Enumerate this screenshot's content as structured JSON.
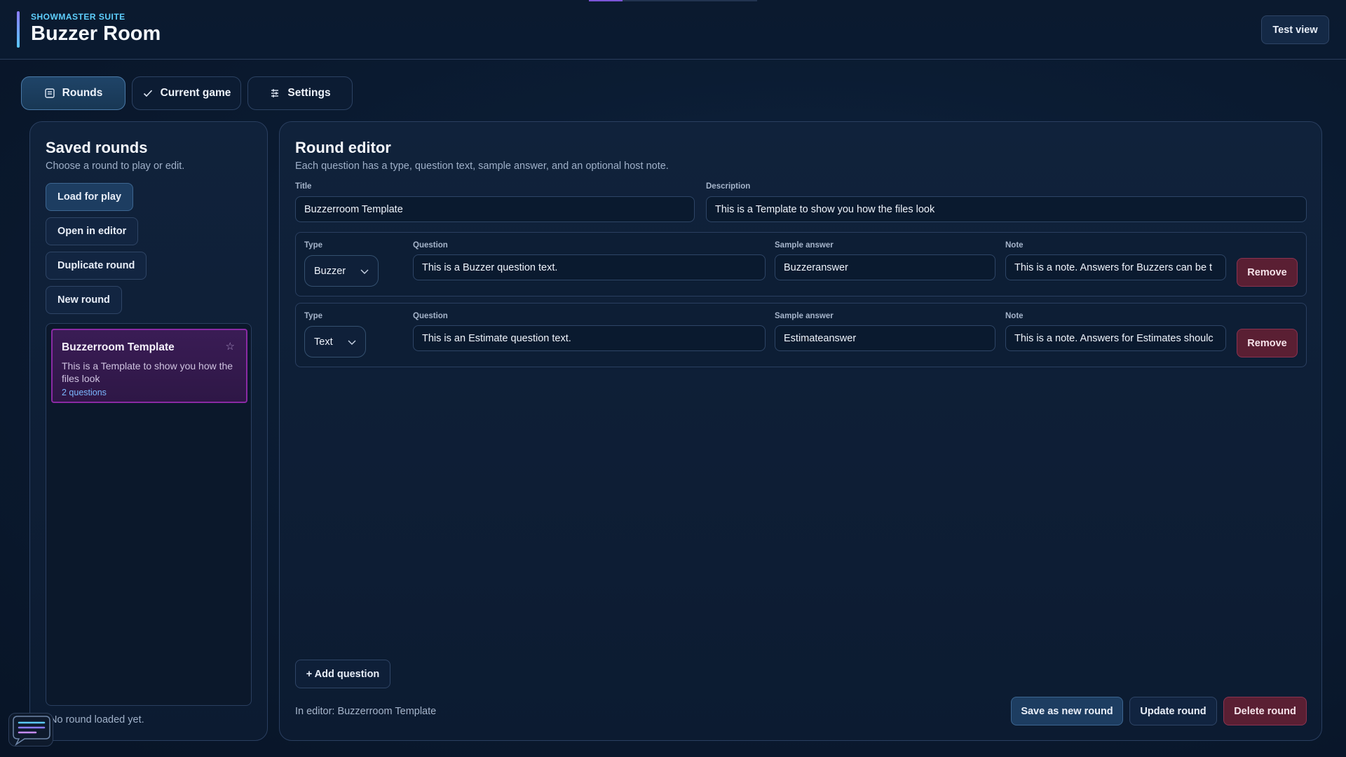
{
  "header": {
    "suite": "SHOWMASTER SUITE",
    "title": "Buzzer Room",
    "test_view_label": "Test view",
    "progress_fraction": 0.2
  },
  "tabs": [
    {
      "label": "Rounds",
      "icon": "list-icon",
      "active": true
    },
    {
      "label": "Current game",
      "icon": "check-icon",
      "active": false
    },
    {
      "label": "Settings",
      "icon": "sliders-icon",
      "active": false
    }
  ],
  "sidebar": {
    "title": "Saved rounds",
    "subtitle": "Choose a round to play or edit.",
    "buttons": {
      "load": "Load for play",
      "open": "Open in editor",
      "duplicate": "Duplicate round",
      "new": "New round"
    },
    "rounds": [
      {
        "title": "Buzzerroom Template",
        "description": "This is a Template to show you how the files look",
        "count": "2 questions"
      }
    ],
    "status": "No round loaded yet."
  },
  "editor": {
    "title": "Round editor",
    "subtitle": "Each question has a type, question text, sample answer, and an optional host note.",
    "labels": {
      "title": "Title",
      "description": "Description",
      "type": "Type",
      "question": "Question",
      "sample_answer": "Sample answer",
      "note": "Note"
    },
    "round_title": "Buzzerroom Template",
    "round_description": "This is a Template to show you how the files look",
    "questions": [
      {
        "type": "Buzzer",
        "question": "This is a Buzzer question text.",
        "answer": "Buzzeranswer",
        "note": "This is a note. Answers for Buzzers can be t"
      },
      {
        "type": "Text",
        "question": "This is an Estimate question text.",
        "answer": "Estimateanswer",
        "note": "This is a note. Answers for Estimates shoulc"
      }
    ],
    "remove_label": "Remove",
    "add_question_label": "+ Add question",
    "in_editor": "In editor: Buzzerroom Template",
    "save_new_label": "Save as new round",
    "update_label": "Update round",
    "delete_label": "Delete round"
  },
  "colors": {
    "accent_cyan": "#5fd0ff",
    "selected_round": "#8a2aa4",
    "danger": "#5a1f33",
    "primary": "#1d3d61"
  }
}
